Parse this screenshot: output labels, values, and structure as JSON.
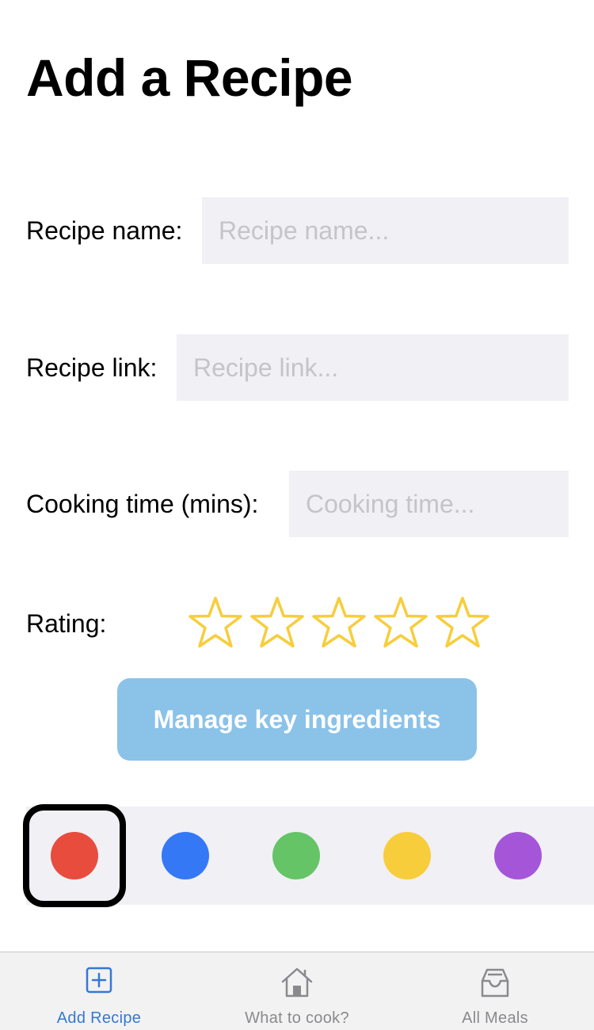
{
  "page": {
    "title": "Add a Recipe"
  },
  "form": {
    "name_label": "Recipe name:",
    "name_placeholder": "Recipe name...",
    "name_value": "",
    "link_label": "Recipe link:",
    "link_placeholder": "Recipe link...",
    "link_value": "",
    "time_label": "Cooking time (mins):",
    "time_placeholder": "Cooking time...",
    "time_value": "",
    "rating_label": "Rating:",
    "rating_value": 0,
    "rating_max": 5,
    "star_color": "#f7cd3b"
  },
  "manage_button": {
    "label": "Manage key ingredients"
  },
  "colors": {
    "selected": "red",
    "options": [
      {
        "name": "red",
        "hex": "#e84c3d"
      },
      {
        "name": "blue",
        "hex": "#3478f6"
      },
      {
        "name": "green",
        "hex": "#65c466"
      },
      {
        "name": "yellow",
        "hex": "#f7cd3b"
      },
      {
        "name": "purple",
        "hex": "#a556d8"
      }
    ]
  },
  "tabbar": {
    "active": "add_recipe",
    "active_color": "#3478d4",
    "inactive_color": "#8a8a8e",
    "tabs": [
      {
        "id": "add_recipe",
        "label": "Add Recipe",
        "icon": "plus-square-icon"
      },
      {
        "id": "what_to_cook",
        "label": "What to cook?",
        "icon": "house-icon"
      },
      {
        "id": "all_meals",
        "label": "All Meals",
        "icon": "tray-icon"
      }
    ]
  }
}
